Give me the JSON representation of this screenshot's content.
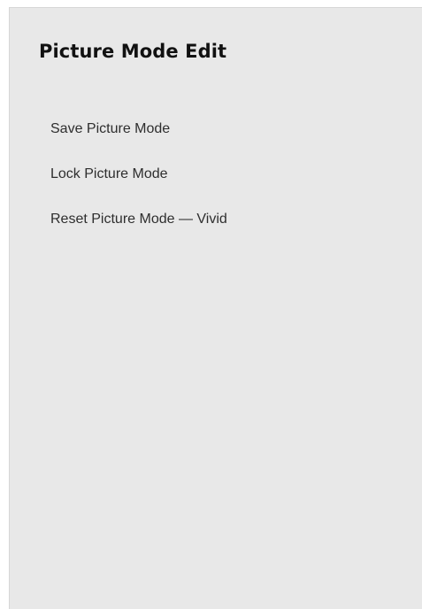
{
  "panel": {
    "title": "Picture Mode Edit",
    "items": [
      {
        "label": "Save Picture Mode"
      },
      {
        "label": "Lock Picture Mode"
      },
      {
        "label": "Reset Picture Mode — Vivid"
      }
    ]
  }
}
